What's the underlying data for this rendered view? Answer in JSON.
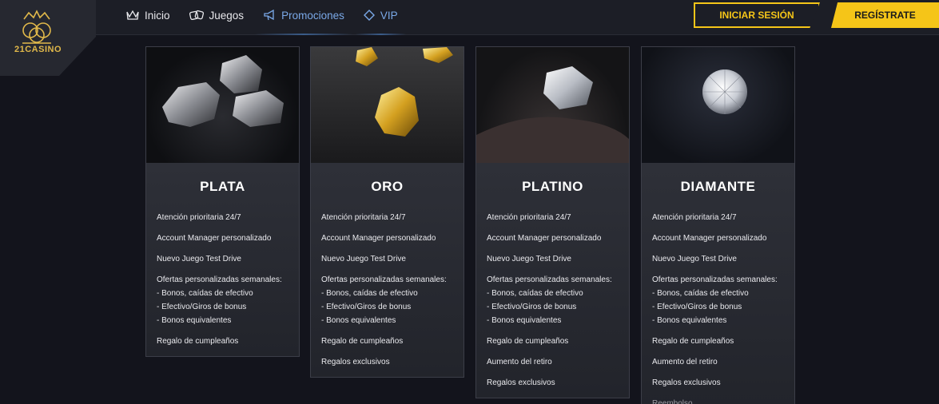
{
  "logo": {
    "text": "21CASINO"
  },
  "nav": [
    {
      "label": "Inicio",
      "icon": "crown-icon"
    },
    {
      "label": "Juegos",
      "icon": "dice-icon"
    },
    {
      "label": "Promociones",
      "icon": "megaphone-icon"
    },
    {
      "label": "VIP",
      "icon": "diamond-icon"
    }
  ],
  "buttons": {
    "login": "INICIAR SESIÓN",
    "register": "REGÍSTRATE"
  },
  "colors": {
    "accent": "#f5c518",
    "nav_active": "#7aa9e8",
    "background": "#13141c"
  },
  "tiers": [
    {
      "title": "PLATA",
      "features": [
        "Atención prioritaria 24/7",
        "Account Manager personalizado",
        "Nuevo Juego Test Drive",
        [
          "Ofertas personalizadas semanales:",
          "- Bonos, caídas de efectivo",
          "- Efectivo/Giros de bonus",
          "- Bonos equivalentes"
        ],
        "Regalo de cumpleaños"
      ]
    },
    {
      "title": "ORO",
      "features": [
        "Atención prioritaria 24/7",
        "Account Manager personalizado",
        "Nuevo Juego Test Drive",
        [
          "Ofertas personalizadas semanales:",
          "- Bonos, caídas de efectivo",
          "- Efectivo/Giros de bonus",
          "- Bonos equivalentes"
        ],
        "Regalo de cumpleaños",
        "Regalos exclusivos"
      ]
    },
    {
      "title": "PLATINO",
      "features": [
        "Atención prioritaria 24/7",
        "Account Manager personalizado",
        "Nuevo Juego Test Drive",
        [
          "Ofertas personalizadas semanales:",
          "- Bonos, caídas de efectivo",
          "- Efectivo/Giros de bonus",
          "- Bonos equivalentes"
        ],
        "Regalo de cumpleaños",
        "Aumento del retiro",
        "Regalos exclusivos"
      ]
    },
    {
      "title": "DIAMANTE",
      "features": [
        "Atención prioritaria 24/7",
        "Account Manager personalizado",
        "Nuevo Juego Test Drive",
        [
          "Ofertas personalizadas semanales:",
          "- Bonos, caídas de efectivo",
          "- Efectivo/Giros de bonus",
          "- Bonos equivalentes"
        ],
        "Regalo de cumpleaños",
        "Aumento del retiro",
        "Regalos exclusivos",
        "Reembolso"
      ]
    }
  ]
}
